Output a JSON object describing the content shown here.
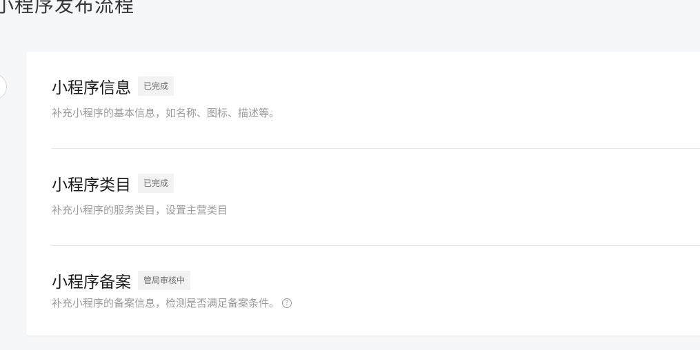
{
  "page": {
    "title": "小程序发布流程"
  },
  "steps": [
    {
      "title": "小程序信息",
      "status": "已完成",
      "description": "补充小程序的基本信息，如名称、图标、描述等。"
    },
    {
      "title": "小程序类目",
      "status": "已完成",
      "description": "补充小程序的服务类目，设置主营类目"
    },
    {
      "title": "小程序备案",
      "status": "管局审核中",
      "description": "补充小程序的备案信息，检测是否满足备案条件。",
      "help_icon": "question-circle-icon",
      "help_glyph": "?"
    }
  ],
  "colors": {
    "background": "#f6f7f9",
    "card": "#ffffff",
    "badge_bg": "#f2f2f2",
    "muted_text": "#9a9a9a"
  }
}
